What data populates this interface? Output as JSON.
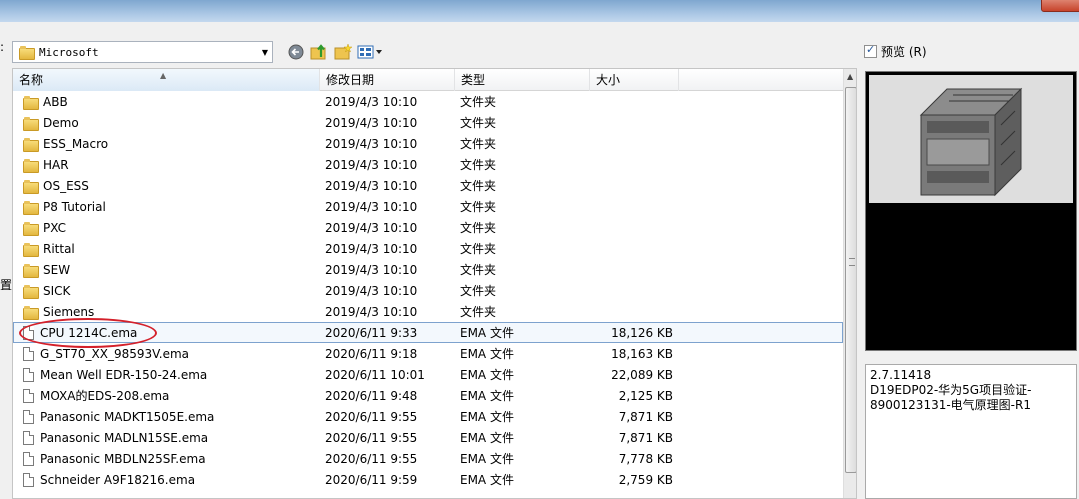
{
  "location": {
    "folder": "Microsoft"
  },
  "side_labels": {
    "top": ":",
    "middle": "置"
  },
  "columns": {
    "name": "名称",
    "date": "修改日期",
    "type": "类型",
    "size": "大小"
  },
  "rows": [
    {
      "name": "ABB",
      "date": "2019/4/3 10:10",
      "type": "文件夹",
      "size": "",
      "kind": "folder"
    },
    {
      "name": "Demo",
      "date": "2019/4/3 10:10",
      "type": "文件夹",
      "size": "",
      "kind": "folder"
    },
    {
      "name": "ESS_Macro",
      "date": "2019/4/3 10:10",
      "type": "文件夹",
      "size": "",
      "kind": "folder"
    },
    {
      "name": "HAR",
      "date": "2019/4/3 10:10",
      "type": "文件夹",
      "size": "",
      "kind": "folder"
    },
    {
      "name": "OS_ESS",
      "date": "2019/4/3 10:10",
      "type": "文件夹",
      "size": "",
      "kind": "folder"
    },
    {
      "name": "P8 Tutorial",
      "date": "2019/4/3 10:10",
      "type": "文件夹",
      "size": "",
      "kind": "folder"
    },
    {
      "name": "PXC",
      "date": "2019/4/3 10:10",
      "type": "文件夹",
      "size": "",
      "kind": "folder"
    },
    {
      "name": "Rittal",
      "date": "2019/4/3 10:10",
      "type": "文件夹",
      "size": "",
      "kind": "folder"
    },
    {
      "name": "SEW",
      "date": "2019/4/3 10:10",
      "type": "文件夹",
      "size": "",
      "kind": "folder"
    },
    {
      "name": "SICK",
      "date": "2019/4/3 10:10",
      "type": "文件夹",
      "size": "",
      "kind": "folder"
    },
    {
      "name": "Siemens",
      "date": "2019/4/3 10:10",
      "type": "文件夹",
      "size": "",
      "kind": "folder"
    },
    {
      "name": "CPU 1214C.ema",
      "date": "2020/6/11 9:33",
      "type": "EMA 文件",
      "size": "18,126 KB",
      "kind": "file"
    },
    {
      "name": "G_ST70_XX_98593V.ema",
      "date": "2020/6/11 9:18",
      "type": "EMA 文件",
      "size": "18,163 KB",
      "kind": "file"
    },
    {
      "name": "Mean Well EDR-150-24.ema",
      "date": "2020/6/11 10:01",
      "type": "EMA 文件",
      "size": "22,089 KB",
      "kind": "file"
    },
    {
      "name": "MOXA的EDS-208.ema",
      "date": "2020/6/11 9:48",
      "type": "EMA 文件",
      "size": "2,125 KB",
      "kind": "file"
    },
    {
      "name": "Panasonic MADKT1505E.ema",
      "date": "2020/6/11 9:55",
      "type": "EMA 文件",
      "size": "7,871 KB",
      "kind": "file"
    },
    {
      "name": "Panasonic MADLN15SE.ema",
      "date": "2020/6/11 9:55",
      "type": "EMA 文件",
      "size": "7,871 KB",
      "kind": "file"
    },
    {
      "name": "Panasonic MBDLN25SF.ema",
      "date": "2020/6/11 9:55",
      "type": "EMA 文件",
      "size": "7,778 KB",
      "kind": "file"
    },
    {
      "name": "Schneider A9F18216.ema",
      "date": "2020/6/11 9:59",
      "type": "EMA 文件",
      "size": "2,759 KB",
      "kind": "file"
    }
  ],
  "selected_index": 11,
  "preview": {
    "label": "预览 (R)",
    "checked": true
  },
  "info": {
    "line1": "2.7.11418",
    "line2": "D19EDP02-华为5G项目验证-",
    "line3": "8900123131-电气原理图-R1"
  },
  "colors": {
    "selection_border": "#7da2ce",
    "annotation_circle": "#d4202a",
    "title_bar": "#a9c6e4"
  }
}
